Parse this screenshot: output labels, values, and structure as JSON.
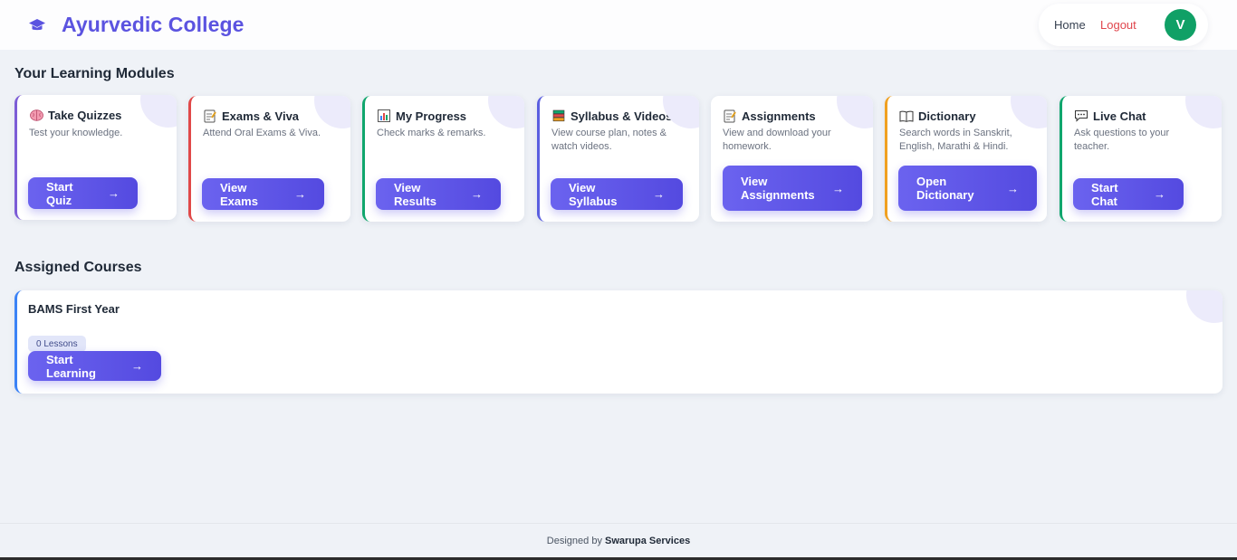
{
  "header": {
    "brand": "Ayurvedic College",
    "brand_icon": "graduation-cap-icon",
    "nav": {
      "home": "Home",
      "logout": "Logout",
      "avatar_initial": "V"
    }
  },
  "modules_title": "Your Learning Modules",
  "modules": [
    {
      "title": "Take Quizzes",
      "icon": "brain-icon",
      "desc": "Test your knowledge.",
      "button": "Start Quiz",
      "accent": "#7c5cd6"
    },
    {
      "title": "Exams & Viva",
      "icon": "memo-icon",
      "desc": "Attend Oral Exams & Viva.",
      "button": "View Exams",
      "accent": "#e04848"
    },
    {
      "title": "My Progress",
      "icon": "bar-chart-icon",
      "desc": "Check marks & remarks.",
      "button": "View Results",
      "accent": "#10a66d"
    },
    {
      "title": "Syllabus & Videos",
      "icon": "books-icon",
      "desc": "View course plan, notes & watch videos.",
      "button": "View Syllabus",
      "accent": "#5b5fe0"
    },
    {
      "title": "Assignments",
      "icon": "memo-icon",
      "desc": "View and download your homework.",
      "button": "View Assignments",
      "accent": "#ffffff"
    },
    {
      "title": "Dictionary",
      "icon": "book-icon",
      "desc": "Search words in Sanskrit, English, Marathi & Hindi.",
      "button": "Open Dictionary",
      "accent": "#f0a020"
    },
    {
      "title": "Live Chat",
      "icon": "speech-bubble-icon",
      "desc": "Ask questions to your teacher.",
      "button": "Start Chat",
      "accent": "#10a66d"
    }
  ],
  "courses_title": "Assigned Courses",
  "courses": [
    {
      "title": "BAMS First Year",
      "badge": "0 Lessons",
      "button": "Start Learning"
    }
  ],
  "footer": {
    "prefix": "Designed by",
    "company": "Swarupa Services"
  }
}
